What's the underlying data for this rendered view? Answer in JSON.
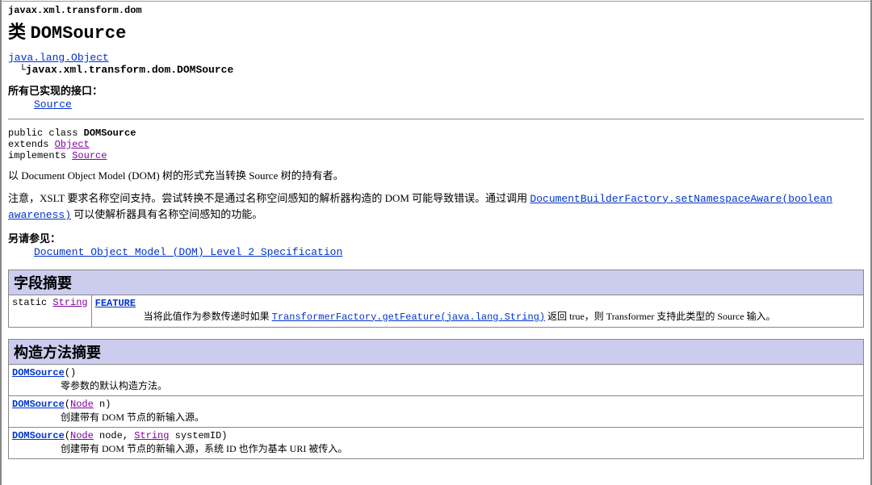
{
  "package": "javax.xml.transform.dom",
  "classPrefix": "类 ",
  "className": "DOMSource",
  "tree": {
    "root": "java.lang.Object",
    "child": "javax.xml.transform.dom.DOMSource"
  },
  "implementedLabel": "所有已实现的接口：",
  "implementedLink": "Source",
  "decl": {
    "line1a": "public class ",
    "line1b": "DOMSource",
    "line2a": "extends ",
    "line2link": "Object",
    "line3a": "implements ",
    "line3link": "Source"
  },
  "para1": "以 Document Object Model (DOM) 树的形式充当转换 Source 树的持有者。",
  "para2a": "注意，XSLT 要求名称空间支持。尝试转换不是通过名称空间感知的解析器构造的 DOM 可能导致错误。通过调用 ",
  "para2link": "DocumentBuilderFactory.setNamespaceAware(boolean awareness)",
  "para2b": " 可以使解析器具有名称空间感知的功能。",
  "seeAlsoLabel": "另请参见：",
  "seeAlsoLink": "Document Object Model (DOM) Level 2 Specification",
  "fieldSummary": {
    "title": "字段摘要",
    "row": {
      "modifiers": "static ",
      "modType": "String",
      "name": "FEATURE",
      "desc1": "当将此值作为参数传递时如果 ",
      "descLink": "TransformerFactory.getFeature(java.lang.String)",
      "desc2": " 返回 true，则 Transformer 支持此类型的 Source 输入。"
    }
  },
  "ctorSummary": {
    "title": "构造方法摘要",
    "rows": [
      {
        "name": "DOMSource",
        "sigA": "()",
        "params": [],
        "desc": "零参数的默认构造方法。"
      },
      {
        "name": "DOMSource",
        "sigA": "(",
        "params": [
          {
            "type": "Node",
            "name": " n"
          }
        ],
        "sigB": ")",
        "desc": "创建带有 DOM 节点的新输入源。"
      },
      {
        "name": "DOMSource",
        "sigA": "(",
        "params": [
          {
            "type": "Node",
            "name": " node, "
          },
          {
            "type": "String",
            "name": " systemID"
          }
        ],
        "sigB": ")",
        "desc": "创建带有 DOM 节点的新输入源，系统 ID 也作为基本 URI 被传入。"
      }
    ]
  }
}
